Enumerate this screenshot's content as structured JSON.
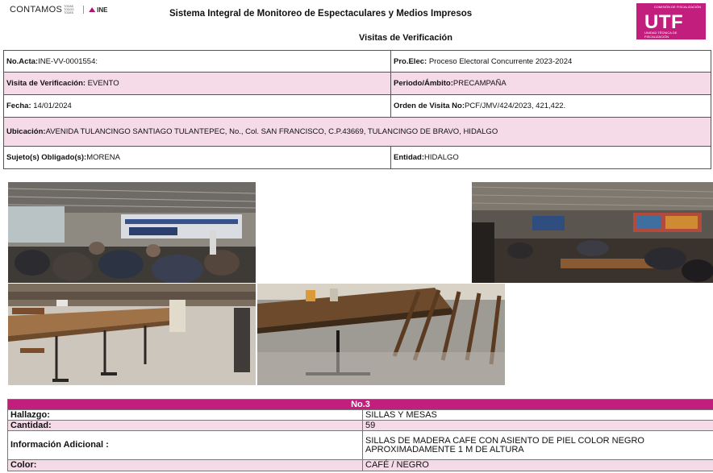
{
  "header": {
    "brand_word": "CONTAMOS",
    "brand_small": "TODAS TODOS TODES",
    "brand_ine": "INE",
    "system_title": "Sistema Integral de Monitoreo de Espectaculares y Medios Impresos",
    "subtitle": "Visitas de Verificación",
    "logo": {
      "top_text": "COMISIÓN DE FISCALIZACIÓN",
      "main": "UTF",
      "sub_text": "UNIDAD TÉCNICA DE FISCALIZACIÓN"
    }
  },
  "info": {
    "acta_label": "No.Acta:",
    "acta_value": "INE-VV-0001554:",
    "proceso_label": "Pro.Elec:",
    "proceso_value": " Proceso Electoral Concurrente 2023-2024",
    "visita_label": "Visita de Verificación:",
    "visita_value": " EVENTO",
    "periodo_label": "Periodo/Ámbito:",
    "periodo_value": "PRECAMPAÑA",
    "fecha_label": "Fecha:",
    "fecha_value": " 14/01/2024",
    "orden_label": "Orden de Visita No:",
    "orden_value": "PCF/JMV/424/2023, 421,422.",
    "ubicacion_label": "Ubicación:",
    "ubicacion_value": "AVENIDA TULANCINGO SANTIAGO TULANTEPEC, No., Col. SAN FRANCISCO, C.P.43669, TULANCINGO DE BRAVO, HIDALGO",
    "sujeto_label": "Sujeto(s) Obligado(s):",
    "sujeto_value": "MORENA",
    "entidad_label": "Entidad:",
    "entidad_value": "HIDALGO"
  },
  "finding": {
    "number": "No.3",
    "rows": [
      {
        "label": "Hallazgo:",
        "value": "SILLAS Y MESAS"
      },
      {
        "label": "Cantidad:",
        "value": "59"
      },
      {
        "label": "Información Adicional :",
        "value": "SILLAS DE MADERA CAFE CON ASIENTO DE PIEL COLOR NEGRO APROXIMADAMENTE 1 M DE ALTURA"
      },
      {
        "label": "Color:",
        "value": "CAFÉ / NEGRO"
      }
    ]
  },
  "colors": {
    "brand_magenta": "#c21e7d",
    "row_pink": "#f4dbe7"
  }
}
